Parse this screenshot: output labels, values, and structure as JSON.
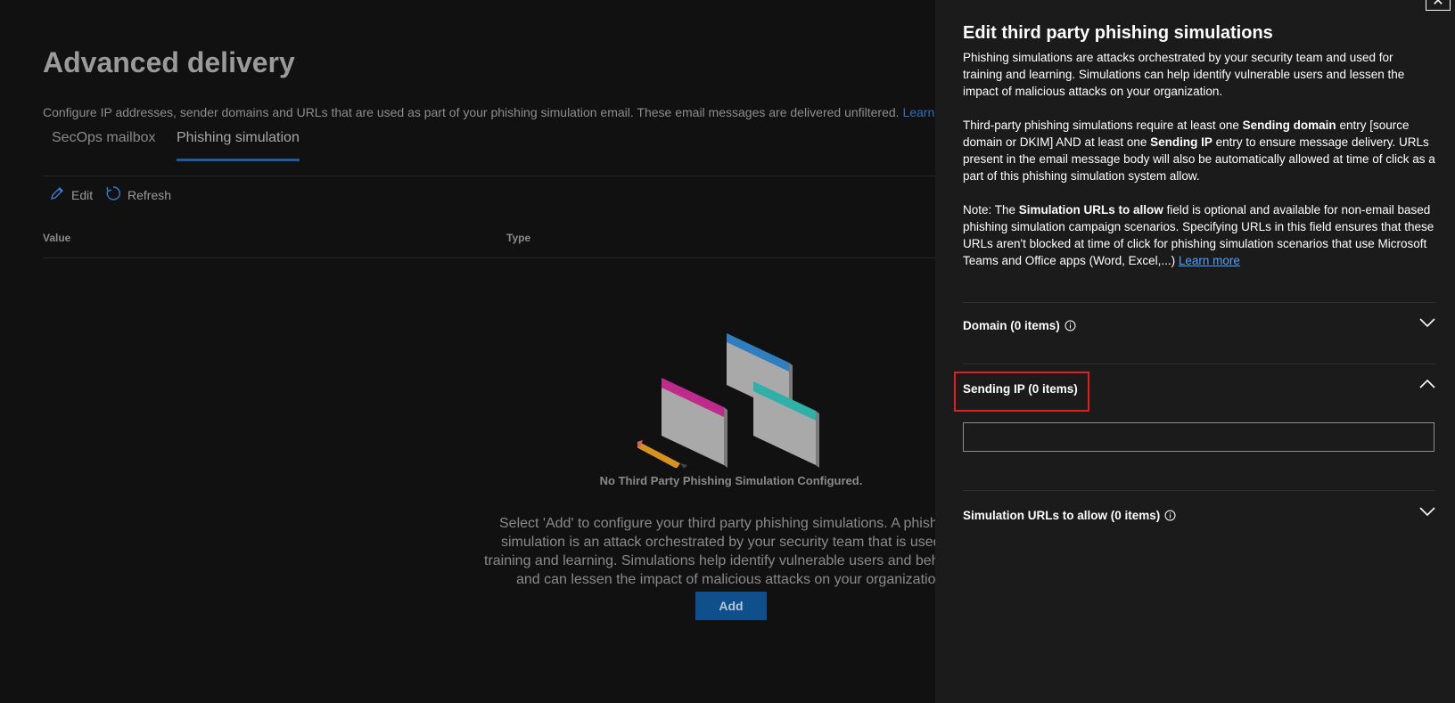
{
  "page": {
    "title": "Advanced delivery",
    "description": "Configure IP addresses, sender domains and URLs that are used as part of your phishing simulation email. These email messages are delivered unfiltered.",
    "learn_more": "Learn more"
  },
  "tabs": [
    {
      "label": "SecOps mailbox",
      "active": false
    },
    {
      "label": "Phishing simulation",
      "active": true
    }
  ],
  "toolbar": {
    "edit_label": "Edit",
    "refresh_label": "Refresh"
  },
  "table": {
    "columns": [
      "Value",
      "Type"
    ]
  },
  "empty_state": {
    "title": "No Third Party Phishing Simulation Configured.",
    "lines": [
      "Select 'Add' to configure your third party phishing simulations. A phishing",
      "simulation is an attack orchestrated by your security team that is used for",
      "training and learning. Simulations help identify vulnerable users and behaviors",
      "and can lessen the impact of malicious attacks on your organization."
    ],
    "add_label": "Add"
  },
  "panel": {
    "close_glyph": "✕",
    "title": "Edit third party phishing simulations",
    "intro": "Phishing simulations are attacks orchestrated by your security team and used for training and learning. Simulations can help identify vulnerable users and lessen the impact of malicious attacks on your organization.",
    "req": {
      "p1": "Third-party phishing simulations require at least one ",
      "b1": "Sending domain",
      "p2": " entry [source domain or DKIM] AND at least one ",
      "b2": "Sending IP",
      "p3": " entry to ensure message delivery. URLs present in the email message body will also be automatically allowed at time of click as a part of this phishing simulation system allow."
    },
    "note": {
      "p1": "Note: The ",
      "b1": "Simulation URLs to allow",
      "p2": " field is optional and available for non-email based phishing simulation campaign scenarios. Specifying URLs in this field ensures that these URLs aren't blocked at time of click for phishing simulation scenarios that use Microsoft Teams and Office apps (Word, Excel,...) ",
      "link": "Learn more"
    },
    "sections": {
      "domain": {
        "label": "Domain (0 items)",
        "expanded": false
      },
      "sending_ip": {
        "label": "Sending IP (0 items)",
        "expanded": true,
        "value": "",
        "placeholder": ""
      },
      "sim_urls": {
        "label": "Simulation URLs to allow (0 items)",
        "expanded": false
      }
    }
  },
  "colors": {
    "accent": "#1b5d9e",
    "highlight": "#e02020",
    "link": "#4aa3ff"
  }
}
